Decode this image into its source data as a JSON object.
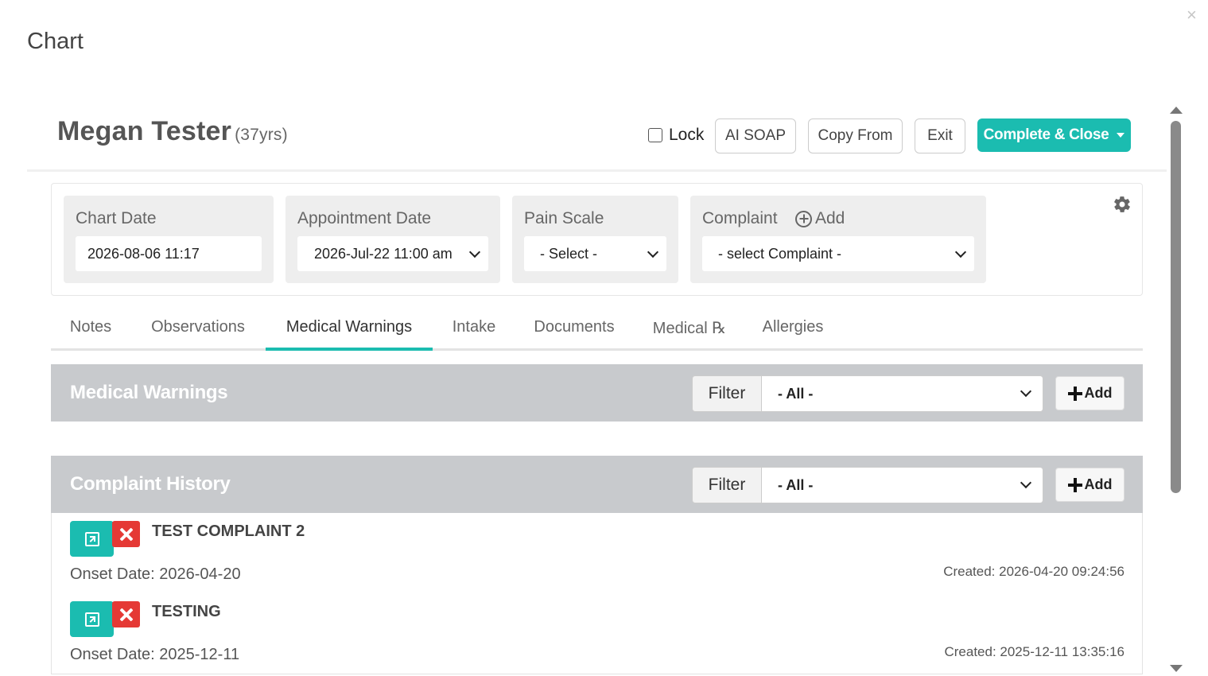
{
  "modal": {
    "title": "Chart",
    "close_glyph": "×"
  },
  "patient": {
    "name": "Megan Tester",
    "age": "(37yrs)"
  },
  "header_actions": {
    "lock_label": "Lock",
    "ai_soap": "AI SOAP",
    "copy_from": "Copy From",
    "exit": "Exit",
    "complete_close": "Complete & Close"
  },
  "fields": {
    "chart_date": {
      "label": "Chart Date",
      "value": "2026-08-06 11:17"
    },
    "appointment_date": {
      "label": "Appointment Date",
      "value": "2026-Jul-22 11:00 am"
    },
    "pain_scale": {
      "label": "Pain Scale",
      "value": "- Select -"
    },
    "complaint": {
      "label": "Complaint",
      "add_label": "Add",
      "value": "- select Complaint -"
    }
  },
  "tabs": [
    {
      "label": "Notes"
    },
    {
      "label": "Observations"
    },
    {
      "label": "Medical Warnings",
      "active": true
    },
    {
      "label": "Intake"
    },
    {
      "label": "Documents"
    },
    {
      "label": "Medical ℞"
    },
    {
      "label": "Allergies"
    }
  ],
  "medical_warnings": {
    "title": "Medical Warnings",
    "filter_label": "Filter",
    "filter_value": "- All -",
    "add_label": "Add"
  },
  "complaint_history": {
    "title": "Complaint History",
    "filter_label": "Filter",
    "filter_value": "- All -",
    "add_label": "Add",
    "items": [
      {
        "title": "TEST COMPLAINT 2",
        "onset": "Onset Date: 2026-04-20",
        "created": "Created: 2026-04-20 09:24:56"
      },
      {
        "title": "TESTING",
        "onset": "Onset Date: 2025-12-11",
        "created": "Created: 2025-12-11 13:35:16"
      }
    ]
  },
  "colors": {
    "accent": "#1bbcb0",
    "danger": "#e53935",
    "panel_header": "#c8cacd"
  }
}
